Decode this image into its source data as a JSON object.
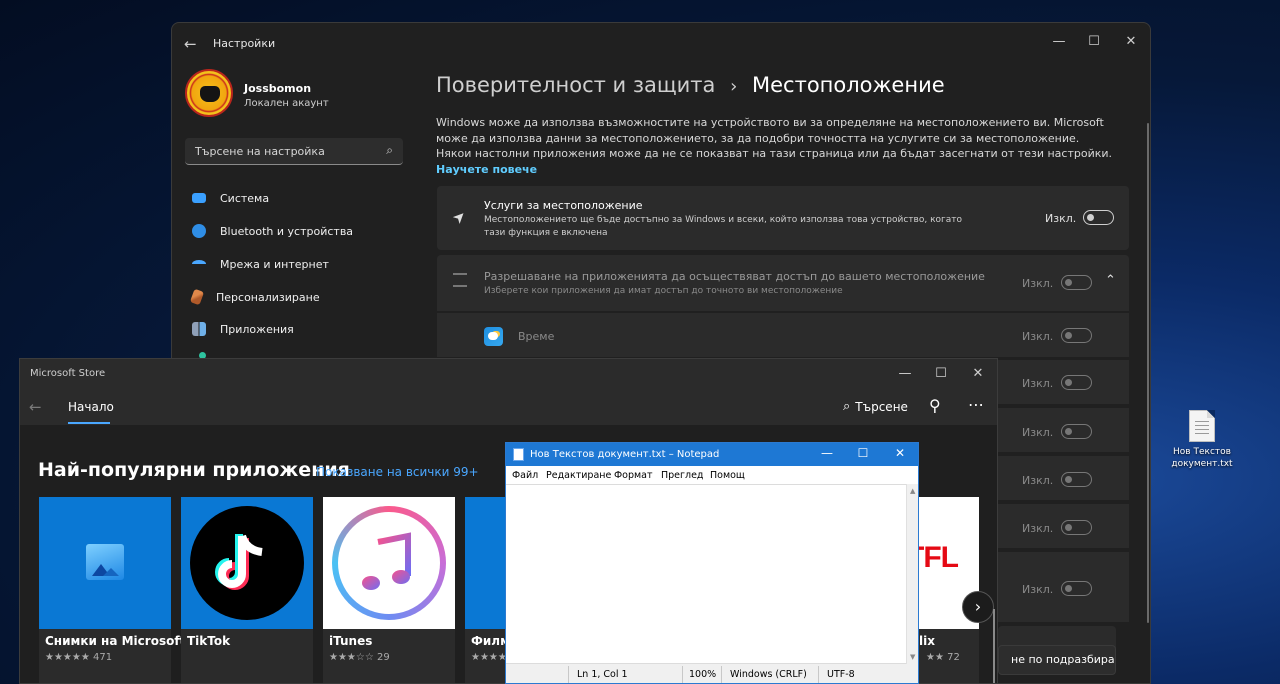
{
  "settings": {
    "title": "Настройки",
    "user_name": "Jossbomon",
    "user_type": "Локален акаунт",
    "search_placeholder": "Търсене на настройка",
    "nav": [
      {
        "label": "Система",
        "icon": "system-icon",
        "color": "#3aa0ff"
      },
      {
        "label": "Bluetooth и устройства",
        "icon": "bluetooth-icon",
        "color": "#2f8ee6"
      },
      {
        "label": "Мрежа и интернет",
        "icon": "wifi-icon",
        "color": "#4aa7ff"
      },
      {
        "label": "Персонализиране",
        "icon": "brush-icon",
        "color": "#e0884a"
      },
      {
        "label": "Приложения",
        "icon": "apps-icon",
        "color": "#8fa0b8"
      }
    ],
    "breadcrumb_parent": "Поверителност и защита",
    "breadcrumb_sep": "›",
    "breadcrumb_current": "Местоположение",
    "description": "Windows може да използва възможностите на устройството ви за определяне на местоположението ви. Microsoft може да използва данни за местоположението, за да подобри точността на услугите си за местоположение. Някои настолни приложения може да не се показват на тази страница или да бъдат засегнати от тези настройки.",
    "learn_more": "Научете повече",
    "location_services": {
      "title": "Услуги за местоположение",
      "subtitle": "Местоположението ще бъде достъпно за Windows и всеки, който използва това устройство, когато тази функция е включена",
      "state": "Изкл."
    },
    "app_access": {
      "title": "Разрешаване на приложенията да осъществяват достъп до вашето местоположение",
      "subtitle": "Изберете кои приложения да имат достъп до точното ви местоположение",
      "state": "Изкл."
    },
    "apps": [
      {
        "name": "Време",
        "state": "Изкл."
      },
      {
        "name": "",
        "state": "Изкл."
      },
      {
        "name": "",
        "state": "Изкл."
      },
      {
        "name": "",
        "state": "Изкл."
      },
      {
        "name": "",
        "state": "Изкл."
      },
      {
        "name": "",
        "state": "Изкл."
      }
    ],
    "default_button": "не по подразбиране"
  },
  "desktop": {
    "file_name": "Нов Текстов документ.txt"
  },
  "store": {
    "title": "Microsoft Store",
    "home_tab": "Начало",
    "search_label": "Търсене",
    "section_title": "Най-популярни приложения",
    "show_all": "Показване на всички 99+",
    "tiles": [
      {
        "name": "Снимки на Microsoft",
        "rating": "★★★★★ 471"
      },
      {
        "name": "TikTok",
        "rating": ""
      },
      {
        "name": "iTunes",
        "rating": "★★★☆☆ 29"
      },
      {
        "name": "Филм",
        "rating": "★★★★"
      },
      {
        "name": "lix",
        "rating": "★★ 72"
      }
    ],
    "netflix_partial": "ETFL"
  },
  "notepad": {
    "title": "Нов Текстов документ.txt – Notepad",
    "menu": [
      "Файл",
      "Редактиране",
      "Формат",
      "Преглед",
      "Помощ"
    ],
    "status": {
      "position": "Ln 1, Col 1",
      "zoom": "100%",
      "line_ending": "Windows (CRLF)",
      "encoding": "UTF-8"
    }
  }
}
